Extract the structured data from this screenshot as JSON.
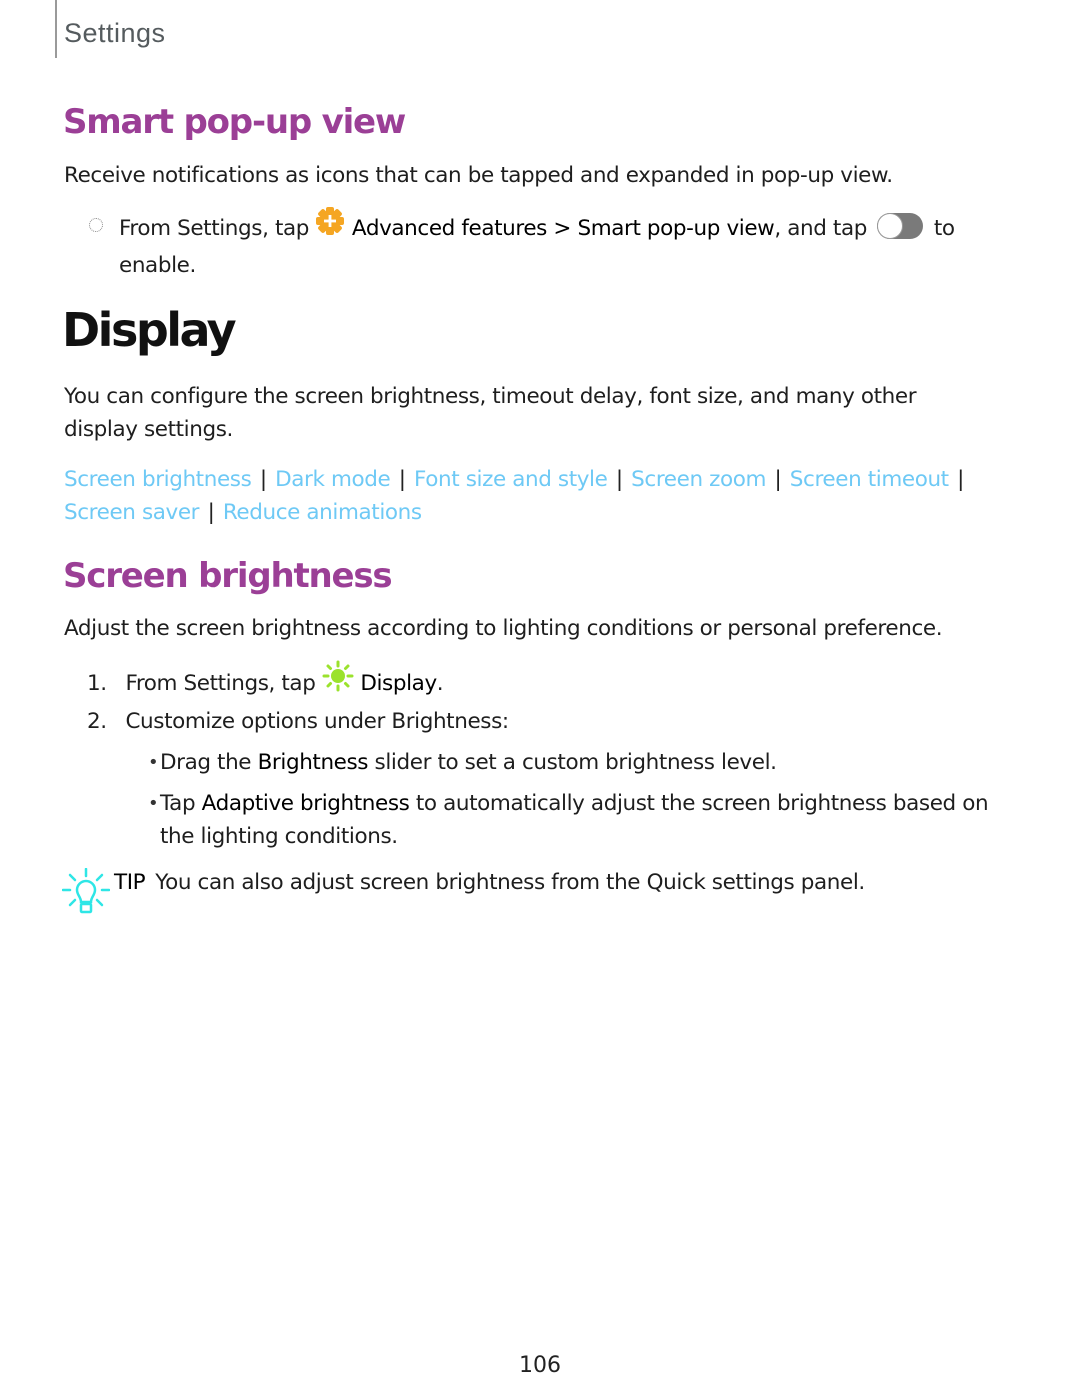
{
  "header": {
    "title": "Settings"
  },
  "smart_popup": {
    "heading": "Smart pop-up view",
    "description": "Receive notifications as icons that can be tapped and expanded in pop-up view.",
    "step": {
      "prefix": "From Settings, tap",
      "icon": "advanced-features-gear-plus-icon",
      "menu": "Advanced features",
      "arrow": ">",
      "item": "Smart pop-up view",
      "middle": ", and tap",
      "toggle_state": "off",
      "suffix_1": "to",
      "suffix_2": "enable."
    }
  },
  "display": {
    "heading": "Display",
    "description": "You can configure the screen brightness, timeout delay, font size, and many other display settings.",
    "links": [
      "Screen brightness",
      "Dark mode",
      "Font size and style",
      "Screen zoom",
      "Screen timeout",
      "Screen saver",
      "Reduce animations"
    ],
    "link_separator": "|",
    "link_color": "#6ec9f5"
  },
  "screen_brightness": {
    "heading": "Screen brightness",
    "description": "Adjust the screen brightness according to lighting conditions or personal preference.",
    "steps": [
      {
        "num": "1.",
        "prefix": "From Settings, tap",
        "icon": "display-sun-icon",
        "target": "Display",
        "suffix": "."
      },
      {
        "num": "2.",
        "text": "Customize options under Brightness:"
      }
    ],
    "bullets": [
      {
        "pre": "Drag the",
        "bold": "Brightness",
        "post": "slider to set a custom brightness level."
      },
      {
        "pre": "Tap",
        "bold": "Adaptive brightness",
        "post": "to automatically adjust the screen brightness based on the lighting conditions."
      }
    ],
    "tip": {
      "label": "TIP",
      "text": "You can also adjust screen brightness from the Quick settings panel."
    }
  },
  "colors": {
    "heading_purple": "#9b3f96",
    "link_blue": "#6ec9f5",
    "gear_orange": "#f5a623",
    "sun_green": "#9be22d",
    "tip_cyan": "#2ee6e6"
  },
  "page_number": "106"
}
